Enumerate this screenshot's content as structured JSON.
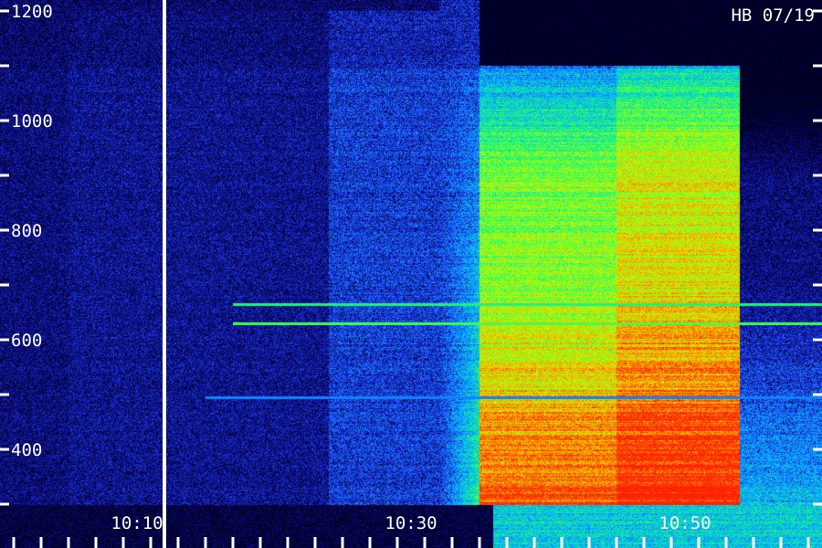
{
  "chart_data": {
    "type": "heatmap",
    "stamp": "HB 07/19",
    "y_axis": {
      "range": [
        300,
        1200
      ],
      "labeled_ticks": [
        {
          "value": 1200,
          "label": "1200"
        },
        {
          "value": 1000,
          "label": "1000"
        },
        {
          "value": 800,
          "label": "800"
        },
        {
          "value": 600,
          "label": "600"
        },
        {
          "value": 400,
          "label": "400"
        }
      ],
      "minor_ticks": [
        300,
        500,
        700,
        900,
        1100
      ]
    },
    "x_axis": {
      "labeled_ticks": [
        {
          "value": "10:10",
          "label": "10:10"
        },
        {
          "value": "10:30",
          "label": "10:30"
        },
        {
          "value": "10:50",
          "label": "10:50"
        }
      ],
      "minor_tick_interval_minutes": 2
    },
    "marker_line_time": "10:10",
    "intensity_regions": [
      {
        "t_start": "10:04",
        "t_end": "10:23",
        "f_low": 300,
        "f_high": 1200,
        "level": 0.15
      },
      {
        "t_start": "10:23",
        "t_end": "10:34",
        "f_low": 300,
        "f_high": 1200,
        "level": 0.25
      },
      {
        "t_start": "10:34",
        "t_end": "10:44",
        "f_low": 300,
        "f_high": 1100,
        "level": 0.65
      },
      {
        "t_start": "10:44",
        "t_end": "10:53",
        "f_low": 300,
        "f_high": 1100,
        "level": 0.75
      }
    ],
    "spectral_lines": [
      {
        "freq": 665,
        "t_start": "10:16",
        "level": 0.55
      },
      {
        "freq": 630,
        "t_start": "10:16",
        "level": 0.6
      },
      {
        "freq": 495,
        "t_start": "10:14",
        "level": 0.35
      }
    ],
    "colormap": [
      "#000030",
      "#1010a0",
      "#2050ff",
      "#00c0ff",
      "#20ff60",
      "#c0ff00",
      "#ffa000",
      "#ff2000"
    ]
  }
}
